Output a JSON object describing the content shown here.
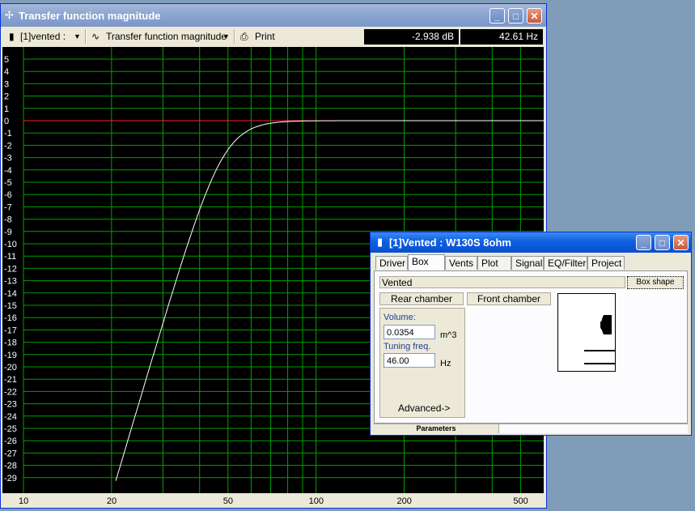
{
  "main_window": {
    "title": "Transfer function magnitude",
    "toolbar": {
      "driver_select": "[1]vented :",
      "plot_select": "Transfer function magnitude",
      "print_label": "Print",
      "readout_db": "-2.938 dB",
      "readout_hz": "42.61 Hz"
    }
  },
  "plot": {
    "y_labels": [
      "5",
      "4",
      "3",
      "2",
      "1",
      "0",
      "-1",
      "-2",
      "-3",
      "-4",
      "-5",
      "-6",
      "-7",
      "-8",
      "-9",
      "-10",
      "-11",
      "-12",
      "-13",
      "-14",
      "-15",
      "-16",
      "-17",
      "-18",
      "-19",
      "-20",
      "-21",
      "-22",
      "-23",
      "-24",
      "-25",
      "-26",
      "-27",
      "-28",
      "-29"
    ],
    "x_labels": [
      "10",
      "20",
      "50",
      "100",
      "200",
      "500"
    ],
    "colors": {
      "grid": "#00a000",
      "curve": "#ffffff",
      "zero_line": "#ff2020",
      "background": "#000000"
    }
  },
  "dialog": {
    "title": "[1]Vented : W130S 8ohm",
    "tabs": [
      "Driver",
      "Box",
      "Vents",
      "Plot",
      "Signal",
      "EQ/Filter",
      "Project"
    ],
    "active_tab": "Box",
    "box_type": "Vented",
    "box_shape_button": "Box shape",
    "rear_chamber_button": "Rear chamber",
    "front_chamber_button": "Front chamber",
    "volume_label": "Volume:",
    "volume_value": "0.0354",
    "volume_unit": "m^3",
    "tuning_label": "Tuning freq.",
    "tuning_value": "46.00",
    "tuning_unit": "Hz",
    "advanced_label": "Advanced->",
    "status_label": "Parameters"
  }
}
